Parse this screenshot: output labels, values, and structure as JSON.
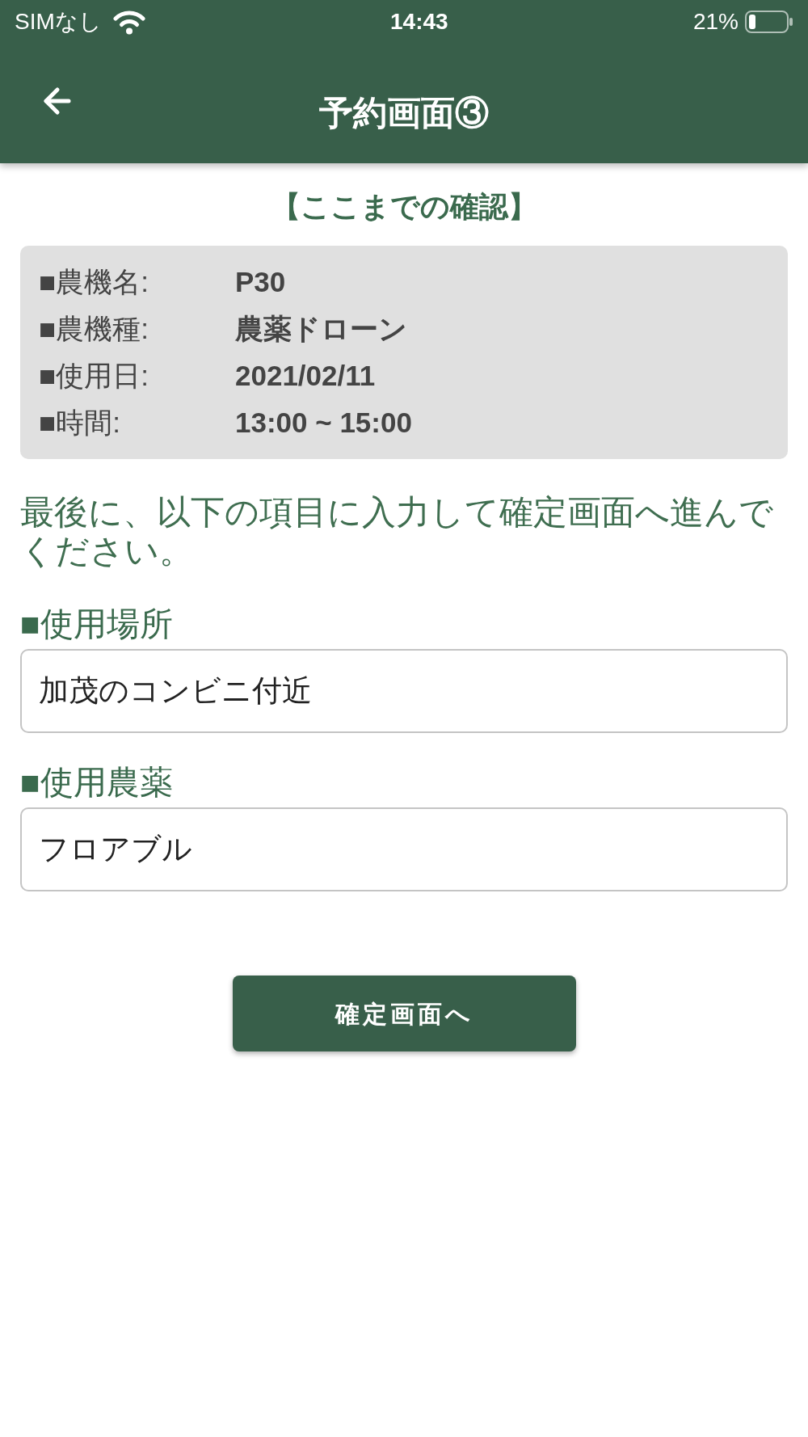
{
  "status_bar": {
    "carrier": "SIMなし",
    "time": "14:43",
    "battery": "21%"
  },
  "header": {
    "title": "予約画面③"
  },
  "summary": {
    "heading": "【ここまでの確認】",
    "rows": [
      {
        "label": "■農機名:",
        "value": "P30"
      },
      {
        "label": "■農機種:",
        "value": "農薬ドローン"
      },
      {
        "label": "■使用日:",
        "value": "2021/02/11"
      },
      {
        "label": "■時間:",
        "value": "13:00 ~ 15:00"
      }
    ]
  },
  "instruction": "最後に、以下の項目に入力して確定画面へ進んでください。",
  "fields": [
    {
      "label": "■使用場所",
      "value": "加茂のコンビニ付近"
    },
    {
      "label": "■使用農薬",
      "value": "フロアブル"
    }
  ],
  "submit_button": {
    "label": "確定画面へ"
  }
}
